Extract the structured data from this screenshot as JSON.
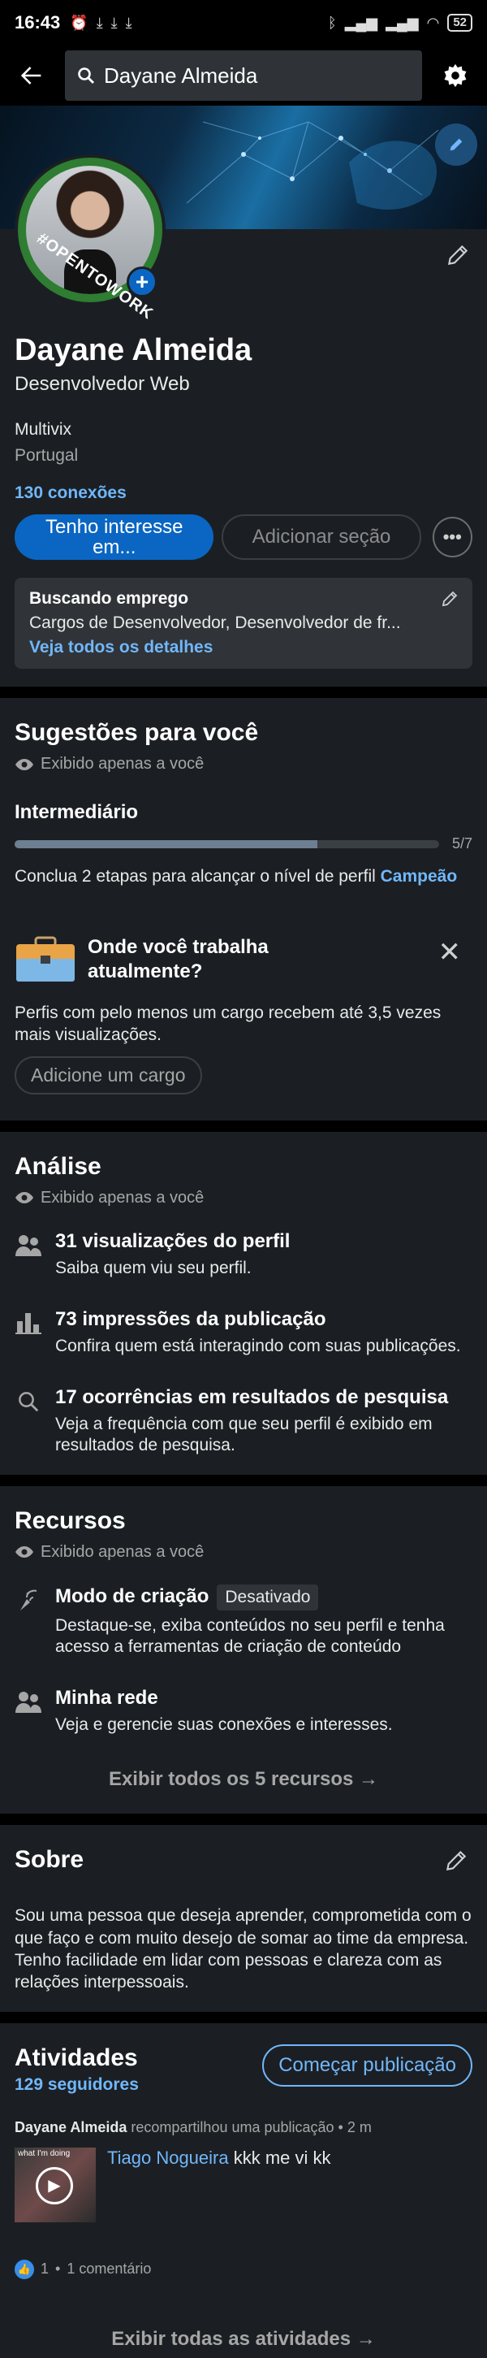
{
  "status_bar": {
    "time": "16:43",
    "battery": "52"
  },
  "search": {
    "value": "Dayane Almeida"
  },
  "profile": {
    "frame_text": "#OPENTOWORK",
    "name": "Dayane Almeida",
    "headline": "Desenvolvedor Web",
    "company": "Multivix",
    "location": "Portugal",
    "connections": "130 conexões",
    "primary_action": "Tenho interesse em...",
    "secondary_action": "Adicionar seção",
    "open_to_work": {
      "title": "Buscando emprego",
      "description": "Cargos de Desenvolvedor, Desenvolvedor de fr...",
      "link": "Veja todos os detalhes"
    }
  },
  "suggestions": {
    "title": "Sugestões para você",
    "private_note": "Exibido apenas a você",
    "level": "Intermediário",
    "progress_label": "5/7",
    "progress_value": 0.714,
    "level_desc_prefix": "Conclua 2 etapas para alcançar o nível de perfil ",
    "level_desc_target": "Campeão",
    "card": {
      "title": "Onde você trabalha atualmente?",
      "description": "Perfis com pelo menos um cargo recebem até 3,5 vezes mais visualizações.",
      "button": "Adicione um cargo"
    }
  },
  "analytics": {
    "title": "Análise",
    "private_note": "Exibido apenas a você",
    "items": [
      {
        "icon": "people-icon",
        "title": "31 visualizações do perfil",
        "desc": "Saiba quem viu seu perfil."
      },
      {
        "icon": "bar-chart-icon",
        "title": "73 impressões da publicação",
        "desc": "Confira quem está interagindo com suas publicações."
      },
      {
        "icon": "search-icon",
        "title": "17 ocorrências em resultados de pesquisa",
        "desc": "Veja a frequência com que seu perfil é exibido em resultados de pesquisa."
      }
    ]
  },
  "resources": {
    "title": "Recursos",
    "private_note": "Exibido apenas a você",
    "items": [
      {
        "icon": "creator-mode-icon",
        "title": "Modo de criação",
        "badge": "Desativado",
        "desc": "Destaque-se, exiba conteúdos no seu perfil e tenha acesso a ferramentas de criação de conteúdo"
      },
      {
        "icon": "people-icon",
        "title": "Minha rede",
        "desc": "Veja e gerencie suas conexões e interesses."
      }
    ],
    "show_all": "Exibir todos os 5 recursos"
  },
  "about": {
    "title": "Sobre",
    "text": "Sou uma pessoa que deseja aprender, comprometida com o que faço e com muito desejo de somar ao time da empresa. Tenho facilidade em lidar com pessoas e clareza com as relações interpessoais."
  },
  "activity": {
    "title": "Atividades",
    "followers": "129 seguidores",
    "post_button": "Começar publicação",
    "meta_author": "Dayane Almeida",
    "meta_rest": " recompartilhou uma publicação • 2 m",
    "thumb_label": "what I'm doing",
    "post_author": "Tiago Nogueira",
    "post_text": " kkk me vi kk",
    "reaction_count": "1",
    "comments": "1 comentário",
    "show_all": "Exibir todas as atividades"
  }
}
